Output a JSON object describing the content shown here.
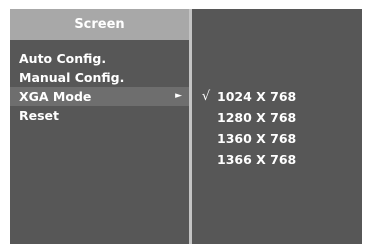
{
  "menu": {
    "title": "Screen",
    "items": [
      {
        "label": "Auto Config."
      },
      {
        "label": "Manual Config."
      },
      {
        "label": "XGA Mode",
        "arrow": "►",
        "selected": true
      },
      {
        "label": "Reset"
      }
    ]
  },
  "submenu": {
    "items": [
      {
        "label": "1024 X 768",
        "check": "√",
        "checked": true
      },
      {
        "label": "1280 X 768",
        "check": ""
      },
      {
        "label": "1360 X 768",
        "check": ""
      },
      {
        "label": "1366 X 768",
        "check": ""
      }
    ]
  },
  "colors": {
    "panel_bg": "#575757",
    "header_bg": "#a8a8a8",
    "highlight_bg": "#6e6e6e",
    "divider": "#c4c4c4",
    "text": "#ffffff"
  }
}
